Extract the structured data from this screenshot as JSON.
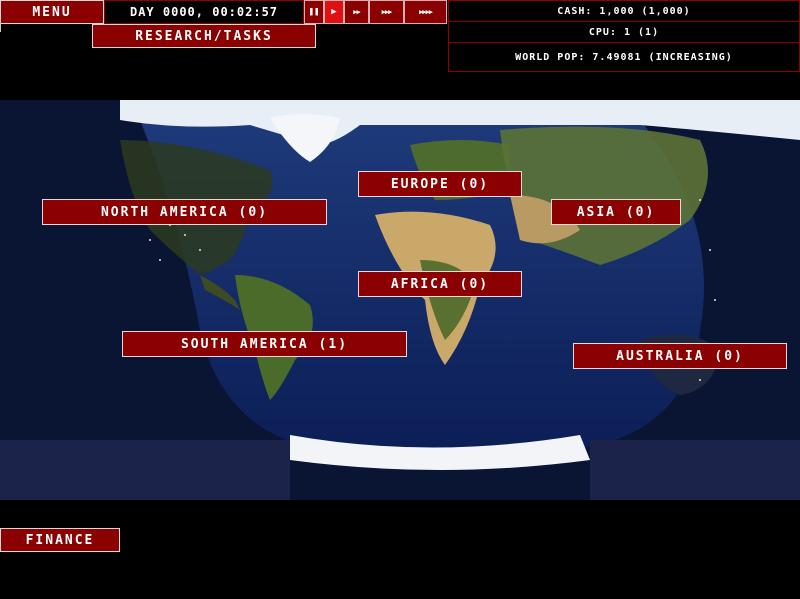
{
  "topbar": {
    "menu_label": "Menu",
    "day_time": "DAY 0000, 00:02:57",
    "research_label": "Research/Tasks",
    "speed_buttons": [
      {
        "icon": "pause-icon",
        "glyph": "❚❚",
        "active": false
      },
      {
        "icon": "play-icon",
        "glyph": "▶",
        "active": true
      },
      {
        "icon": "fast-forward-icon",
        "glyph": "▶▶",
        "active": false
      },
      {
        "icon": "faster-forward-icon",
        "glyph": "▶▶▶",
        "active": false
      },
      {
        "icon": "fastest-forward-icon",
        "glyph": "▶▶▶▶",
        "active": false
      }
    ]
  },
  "stats": {
    "cash": "CASH: 1,000 (1,000)",
    "cpu": "CPU: 1 (1)",
    "world_pop": "WORLD POP: 7.49081 (increasing)"
  },
  "regions": {
    "north_america": "North America (0)",
    "europe": "Europe (0)",
    "asia": "Asia (0)",
    "africa": "Africa (0)",
    "south_america": "South America (1)",
    "australia": "Australia (0)"
  },
  "footer": {
    "finance_label": "Finance"
  },
  "colors": {
    "button_red": "#8b0000",
    "active_red": "#e01010",
    "ocean_dark": "#0d1a44",
    "land_green": "#4a6b2a",
    "desert": "#c9a86a",
    "ice": "#ffffff"
  }
}
